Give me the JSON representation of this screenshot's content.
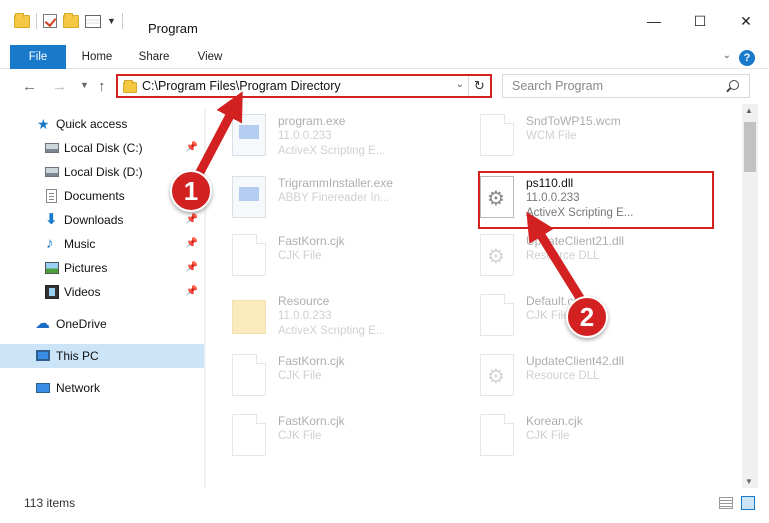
{
  "window": {
    "title": "Program",
    "minimize": "—",
    "maximize": "☐",
    "close": "✕"
  },
  "ribbon": {
    "tabs": [
      "File",
      "Home",
      "Share",
      "View"
    ]
  },
  "address": {
    "path": "C:\\Program Files\\Program Directory"
  },
  "search": {
    "placeholder": "Search Program"
  },
  "sidebar": {
    "items": [
      {
        "label": "Quick access",
        "icon": "star-icon",
        "pinned": false
      },
      {
        "label": "Local Disk (C:)",
        "icon": "drive-icon",
        "pinned": true
      },
      {
        "label": "Local Disk (D:)",
        "icon": "drive-icon",
        "pinned": false
      },
      {
        "label": "Documents",
        "icon": "documents-icon",
        "pinned": true
      },
      {
        "label": "Downloads",
        "icon": "download-icon",
        "pinned": true
      },
      {
        "label": "Music",
        "icon": "music-icon",
        "pinned": true
      },
      {
        "label": "Pictures",
        "icon": "pictures-icon",
        "pinned": true
      },
      {
        "label": "Videos",
        "icon": "videos-icon",
        "pinned": true
      },
      {
        "label": "OneDrive",
        "icon": "cloud-icon",
        "pinned": false
      },
      {
        "label": "This PC",
        "icon": "computer-icon",
        "pinned": false,
        "selected": true
      },
      {
        "label": "Network",
        "icon": "network-icon",
        "pinned": false
      }
    ]
  },
  "files": [
    {
      "name": "program.exe",
      "line2": "11.0.0.233",
      "line3": "ActiveX Scripting E...",
      "icon": "exe-icon"
    },
    {
      "name": "SndToWP15.wcm",
      "line2": "WCM File",
      "line3": "",
      "icon": "document-icon"
    },
    {
      "name": "TrigrammInstaller.exe",
      "line2": "ABBY Finereader In...",
      "line3": "",
      "icon": "exe-icon"
    },
    {
      "name": "ps110.dll",
      "line2": "11.0.0.233",
      "line3": "ActiveX Scripting E...",
      "icon": "dll-icon",
      "highlighted": true
    },
    {
      "name": "FastKorn.cjk",
      "line2": "CJK File",
      "line3": "",
      "icon": "document-icon"
    },
    {
      "name": "UpdateClient21.dll",
      "line2": "Resource DLL",
      "line3": "",
      "icon": "dll-icon"
    },
    {
      "name": "Resource",
      "line2": "11.0.0.233",
      "line3": "ActiveX Scripting E...",
      "icon": "folder-icon"
    },
    {
      "name": "Default.cjk",
      "line2": "CJK File",
      "line3": "",
      "icon": "document-icon"
    },
    {
      "name": "FastKorn.cjk",
      "line2": "CJK File",
      "line3": "",
      "icon": "document-icon"
    },
    {
      "name": "UpdateClient42.dll",
      "line2": "Resource DLL",
      "line3": "",
      "icon": "dll-icon"
    },
    {
      "name": "FastKorn.cjk",
      "line2": "CJK File",
      "line3": "",
      "icon": "document-icon"
    },
    {
      "name": "Korean.cjk",
      "line2": "CJK File",
      "line3": "",
      "icon": "document-icon"
    }
  ],
  "status": {
    "count": "113 items"
  },
  "callouts": {
    "one": "1",
    "two": "2"
  },
  "colors": {
    "accent": "#1979ca",
    "highlight": "#d32020"
  }
}
